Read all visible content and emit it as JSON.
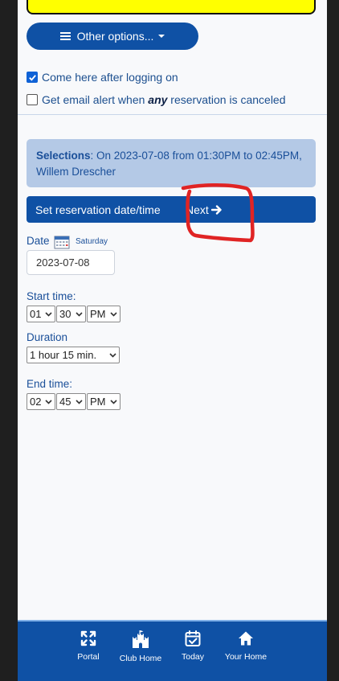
{
  "header": {
    "other_options_label": "Other options..."
  },
  "options": {
    "come_here_label": "Come here after logging on",
    "come_here_checked": true,
    "email_alert_prefix": "Get email alert when ",
    "email_alert_emphasis": "any",
    "email_alert_suffix": " reservation is canceled",
    "email_alert_checked": false
  },
  "selections": {
    "label": "Selections",
    "text": ": On 2023-07-08 from 01:30PM to 02:45PM, Willem Drescher"
  },
  "reservation_bar": {
    "title": "Set reservation date/time",
    "next_label": "Next"
  },
  "form": {
    "date_label": "Date",
    "weekday": "Saturday",
    "date_value": "2023-07-08",
    "start_time_label": "Start time:",
    "start_hour": "01",
    "start_minute": "30",
    "start_ampm": "PM",
    "duration_label": "Duration",
    "duration_value": "1 hour 15 min.",
    "end_time_label": "End time:",
    "end_hour": "02",
    "end_minute": "45",
    "end_ampm": "PM"
  },
  "bottom_nav": [
    {
      "label": "Portal",
      "icon": "expand-arrows-icon"
    },
    {
      "label": "Club Home",
      "icon": "castle-icon"
    },
    {
      "label": "Today",
      "icon": "calendar-check-icon"
    },
    {
      "label": "Your Home",
      "icon": "home-icon"
    }
  ],
  "colors": {
    "primary": "#0f51a5",
    "selection_bg": "#b4c9e6",
    "banner": "#ffff00",
    "annotation": "#e02424"
  }
}
